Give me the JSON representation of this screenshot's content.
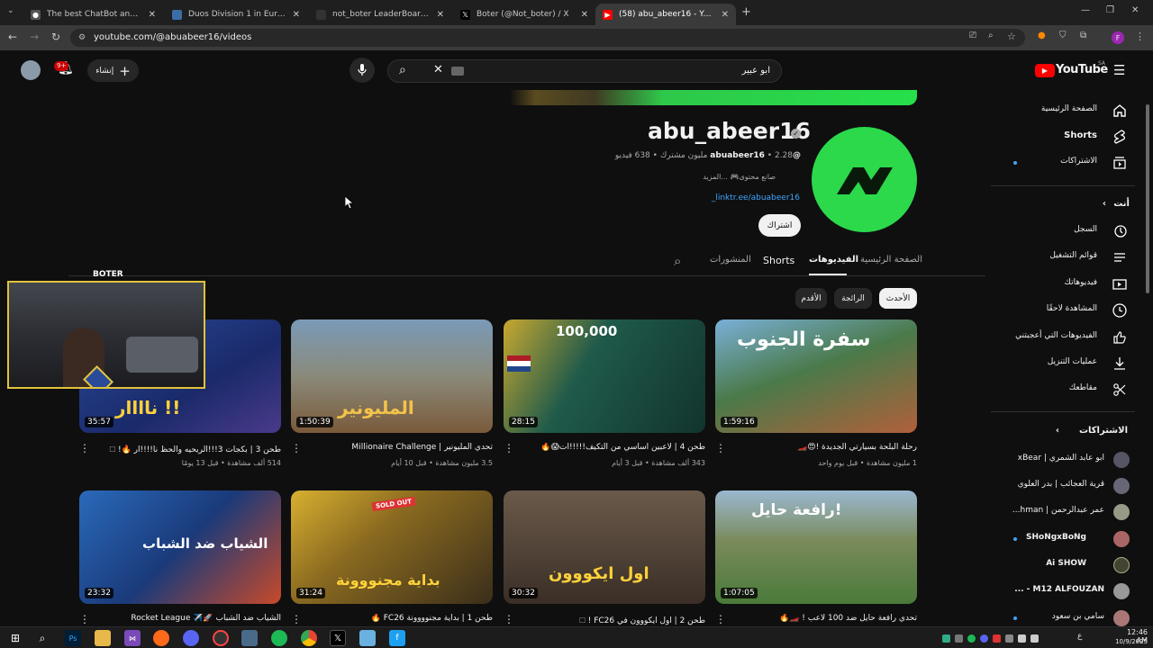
{
  "browser": {
    "tabs": [
      {
        "title": "The best ChatBot and Widgets",
        "active": false
      },
      {
        "title": "Duos Division 1 in Europe: Session",
        "active": false
      },
      {
        "title": "not_boter LeaderBoard | The best",
        "active": false
      },
      {
        "title": "Boter (@Not_boter) / X",
        "active": false
      },
      {
        "title": "(58) abu_abeer16 - YouTube",
        "active": true
      }
    ],
    "url": "youtube.com/@abuabeer16/videos",
    "profile_letter": "F"
  },
  "youtube": {
    "logo_text": "YouTube",
    "region": "SA",
    "search_value": "ابو عبير",
    "create_label": "إنشاء",
    "notif_count": "9+"
  },
  "sidebar": {
    "main": [
      {
        "label": "الصفحة الرئيسية",
        "icon": "home-icon"
      },
      {
        "label": "Shorts",
        "icon": "shorts-icon"
      },
      {
        "label": "الاشتراكات",
        "icon": "subscriptions-icon"
      }
    ],
    "you_header": "أنت",
    "you": [
      {
        "label": "السجل",
        "icon": "history-icon"
      },
      {
        "label": "قوائم التشغيل",
        "icon": "playlist-icon"
      },
      {
        "label": "فيديوهاتك",
        "icon": "your-videos-icon"
      },
      {
        "label": "المشاهدة لاحقًا",
        "icon": "watch-later-icon"
      },
      {
        "label": "الفيديوهات التي أعجبتني",
        "icon": "like-icon"
      },
      {
        "label": "عمليات التنزيل",
        "icon": "download-icon"
      },
      {
        "label": "مقاطعك",
        "icon": "clips-icon"
      }
    ],
    "subs_header": "الاشتراكات",
    "subs": [
      {
        "label": "ابو عابد الشمري | xBear",
        "color": "#556"
      },
      {
        "label": "قرية العجائب | بدر العلوي",
        "color": "#667"
      },
      {
        "label": "عمر عبدالرحمن | hman...",
        "color": "#998"
      },
      {
        "label": "SHoNgxBoNg",
        "color": "#a66"
      },
      {
        "label": "Ai SHOW",
        "color": "#443"
      },
      {
        "label": "M12 ALFOUZAN - ...",
        "color": "#999"
      },
      {
        "label": "سامي بن سعود",
        "color": "#a77"
      }
    ]
  },
  "channel": {
    "name": "abu_abeer16",
    "handle": "@abuabeer16",
    "subscribers": "2.28 مليون مشترك",
    "video_count": "638 فيديو",
    "description": "صانع محتوى🎮 ...المزيد",
    "link": "linktr.ee/abuabeer16_",
    "subscribe_label": "اشتراك",
    "tabs": [
      "الصفحة الرئيسية",
      "الفيديوهات",
      "Shorts",
      "المنشورات"
    ],
    "active_tab": "الفيديوهات",
    "filters": [
      "الأحدث",
      "الرائجة",
      "الأقدم"
    ]
  },
  "videos": [
    {
      "title": "رحلة البلحة بسيارتي الجديدة !😍🏎️",
      "meta": "1 مليون مشاهدة • قبل يوم واحد",
      "duration": "1:59:16",
      "overlay": "سفرة الجنوب",
      "bg": "#3a7a3a"
    },
    {
      "title": "طحن 4 | لاعبين اساسي من التكيف!!!!!ات😱🔥",
      "meta": "343 ألف مشاهدة • قبل 3 أيام",
      "duration": "28:15",
      "overlay": "100,000",
      "bg": "#1b4a3a"
    },
    {
      "title": "تحدي المليونير | Millionaire Challenge",
      "meta": "3.5 مليون مشاهدة • قبل 10 أيام",
      "duration": "1:50:39",
      "overlay": "المليونير",
      "bg": "#6a7a8a"
    },
    {
      "title": "طحن 3 | بكجات 3!!!الريحيه والحظ نا!!!!ار 🔥! 🗆",
      "meta": "514 ألف مشاهدة • قبل 13 يومًا",
      "duration": "35:57",
      "overlay": "ناااار !!",
      "bg": "#2a3a7a"
    },
    {
      "title": "تحدي رافعة حايل ضد 100 لاعب ! 🏎️🔥",
      "meta": "",
      "duration": "1:07:05",
      "overlay": "رافعة حايل!",
      "bg": "#6a8a4a"
    },
    {
      "title": "طحن 2 | اول ايكووون في FC26 ! 🗆",
      "meta": "",
      "duration": "30:32",
      "overlay": "اول ايكووون",
      "bg": "#5a4a3a"
    },
    {
      "title": "طحن 1 | بداية مجنوووونة FC26 🔥",
      "meta": "",
      "duration": "31:24",
      "overlay": "بداية مجنووونة",
      "bg": "#7a6a2a"
    },
    {
      "title": "الشياب ضد الشباب 🚀✈️ Rocket League",
      "meta": "",
      "duration": "23:32",
      "overlay": "الشياب ضد الشباب",
      "bg": "#2a5a8a"
    }
  ],
  "streamer_overlay": {
    "name": "BOTER"
  },
  "taskbar": {
    "time": "12:46 AM",
    "date": "10/9/2025",
    "lang": "ع"
  }
}
